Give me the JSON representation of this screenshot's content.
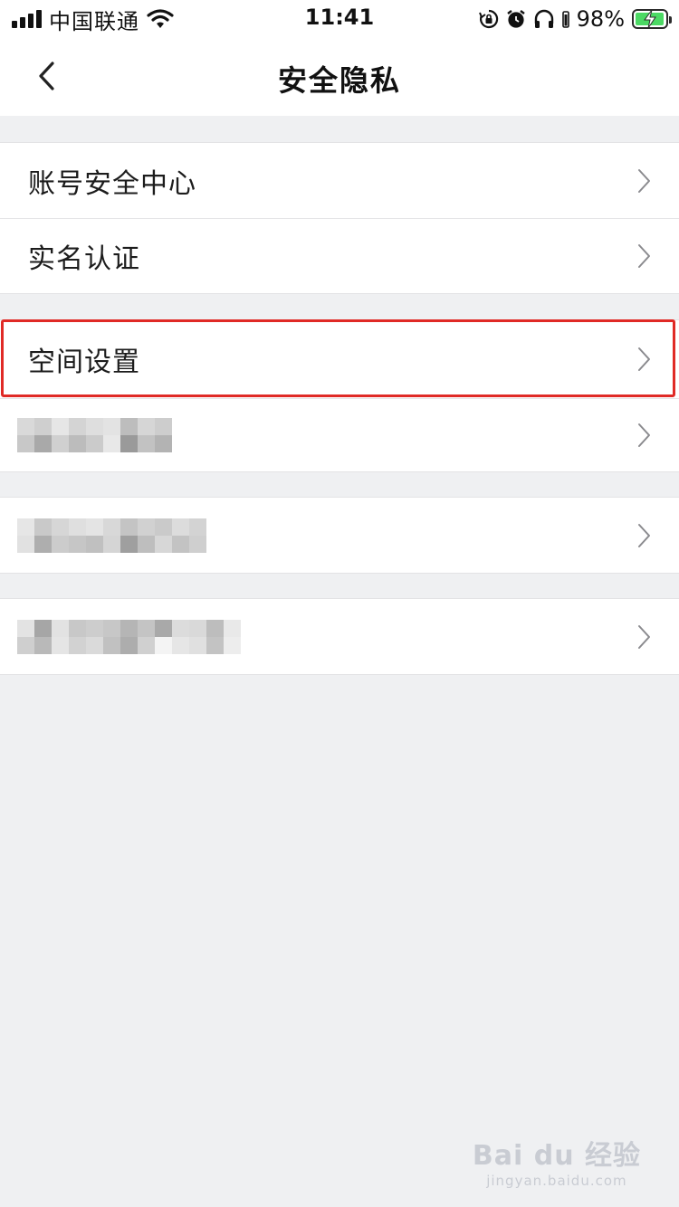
{
  "status_bar": {
    "carrier": "中国联通",
    "time": "11:41",
    "battery": "98%",
    "icons": [
      "signal-icon",
      "wifi-icon",
      "rotation-lock-icon",
      "alarm-icon",
      "headphones-icon",
      "battery-icon"
    ]
  },
  "nav": {
    "title": "安全隐私",
    "back_icon": "chevron-left-icon"
  },
  "groups": [
    {
      "rows": [
        {
          "label": "账号安全中心",
          "icon": "chevron-right-icon"
        },
        {
          "label": "实名认证",
          "icon": "chevron-right-icon"
        }
      ]
    },
    {
      "rows": [
        {
          "label": "空间设置",
          "icon": "chevron-right-icon",
          "highlighted": true
        },
        {
          "label": "",
          "blurred": true,
          "icon": "chevron-right-icon"
        }
      ]
    },
    {
      "rows": [
        {
          "label": "",
          "blurred": true,
          "icon": "chevron-right-icon"
        }
      ]
    },
    {
      "rows": [
        {
          "label": "",
          "blurred": true,
          "icon": "chevron-right-icon"
        }
      ]
    }
  ],
  "watermark": {
    "main": "Bai du 经验",
    "sub": "jingyan.baidu.com"
  },
  "colors": {
    "background": "#eff0f2",
    "highlight_border": "#e02a26",
    "battery_fill": "#4cd964"
  }
}
